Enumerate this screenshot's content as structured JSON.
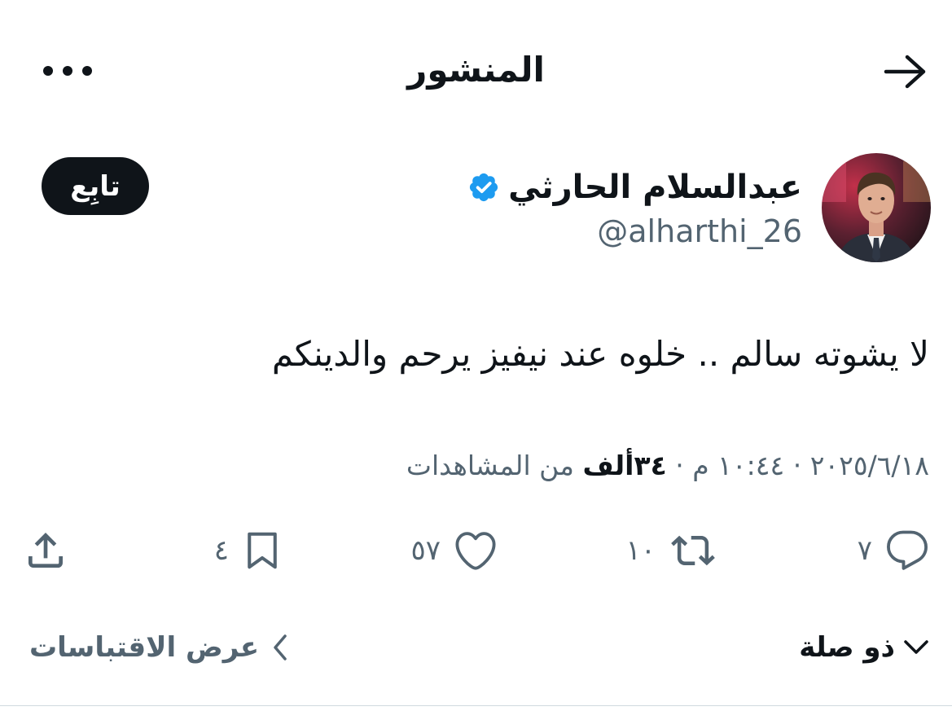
{
  "header": {
    "title": "المنشور",
    "back_icon": "arrow-right-icon",
    "more_icon": "more-horizontal-icon"
  },
  "author": {
    "name": "عبدالسلام الحارثي",
    "handle": "@alharthi_26",
    "verified": true,
    "verified_color": "#1d9bf0",
    "avatar_icon": "user-photo-avatar"
  },
  "follow_button": {
    "label": "تابِع"
  },
  "tweet": {
    "text": "لا يشوته سالم .. خلوه عند نيفيز يرحم والدينكم"
  },
  "meta": {
    "date": "٢٠٢٥/٦/١٨",
    "separator": " · ",
    "time": "١٠:٤٤ م",
    "views_count": "٣٤ألف",
    "views_label": "من المشاهدات"
  },
  "actions": {
    "reply": {
      "icon": "reply-icon",
      "count": "٧"
    },
    "repost": {
      "icon": "repost-icon",
      "count": "١٠"
    },
    "like": {
      "icon": "heart-icon",
      "count": "٥٧"
    },
    "bookmark": {
      "icon": "bookmark-icon",
      "count": "٤"
    },
    "share": {
      "icon": "share-icon"
    }
  },
  "bottom": {
    "relevant_label": "ذو صلة",
    "quotes_label": "عرض الاقتباسات"
  },
  "colors": {
    "text_primary": "#0f1419",
    "text_secondary": "#536471",
    "accent": "#1d9bf0",
    "follow_bg": "#0f1419"
  }
}
